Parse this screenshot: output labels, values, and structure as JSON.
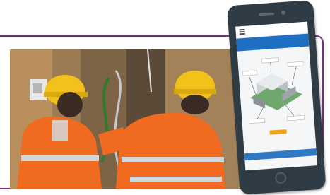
{
  "photo": {
    "subject": "technicians-in-orange-hivis-jackets-and-yellow-helmets",
    "colors": {
      "helmet": "#f2c21a",
      "jacket": "#f06a1f",
      "reflective": "#cfd6d9",
      "wall": "#8a6b46"
    }
  },
  "phone": {
    "logo_text": "",
    "banner_text": "",
    "colors": {
      "body": "#2f3b45",
      "banner": "#1e6fc2",
      "button": "#f1a51d"
    }
  },
  "frame": {
    "color": "#7a2b83"
  }
}
